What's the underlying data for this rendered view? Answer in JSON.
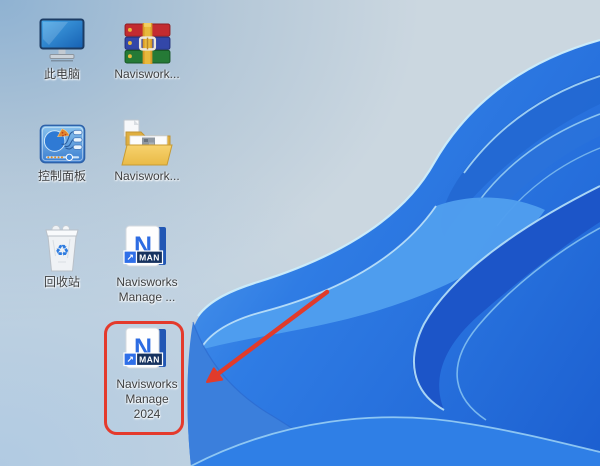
{
  "wallpaper": {
    "name": "windows-11-bloom",
    "bg_light": "#cbd7e0",
    "bg_corner": "#8fb2d2",
    "petal_bright": "#4f9eee",
    "petal_mid": "#2a74de",
    "petal_dark": "#1c55c8",
    "ridge_highlight": "#c2e8fa"
  },
  "annotations": {
    "highlight_box_color": "#e43a2c",
    "arrow_color": "#e13b2b"
  },
  "icons": {
    "this_pc": {
      "label": "此电脑"
    },
    "archive": {
      "label": "Naviswork..."
    },
    "control_panel": {
      "label": "控制面板"
    },
    "folder": {
      "label": "Naviswork..."
    },
    "recycle_bin": {
      "label": "回收站",
      "glyph": "♻"
    },
    "shortcut_trial": {
      "line1": "Navisworks",
      "line2": "Manage ..."
    },
    "shortcut_2024": {
      "line1": "Navisworks",
      "line2": "Manage",
      "line3": "2024"
    }
  },
  "navisworks_badge": {
    "letter": "N",
    "arrow": "↗",
    "text": "MAN"
  }
}
